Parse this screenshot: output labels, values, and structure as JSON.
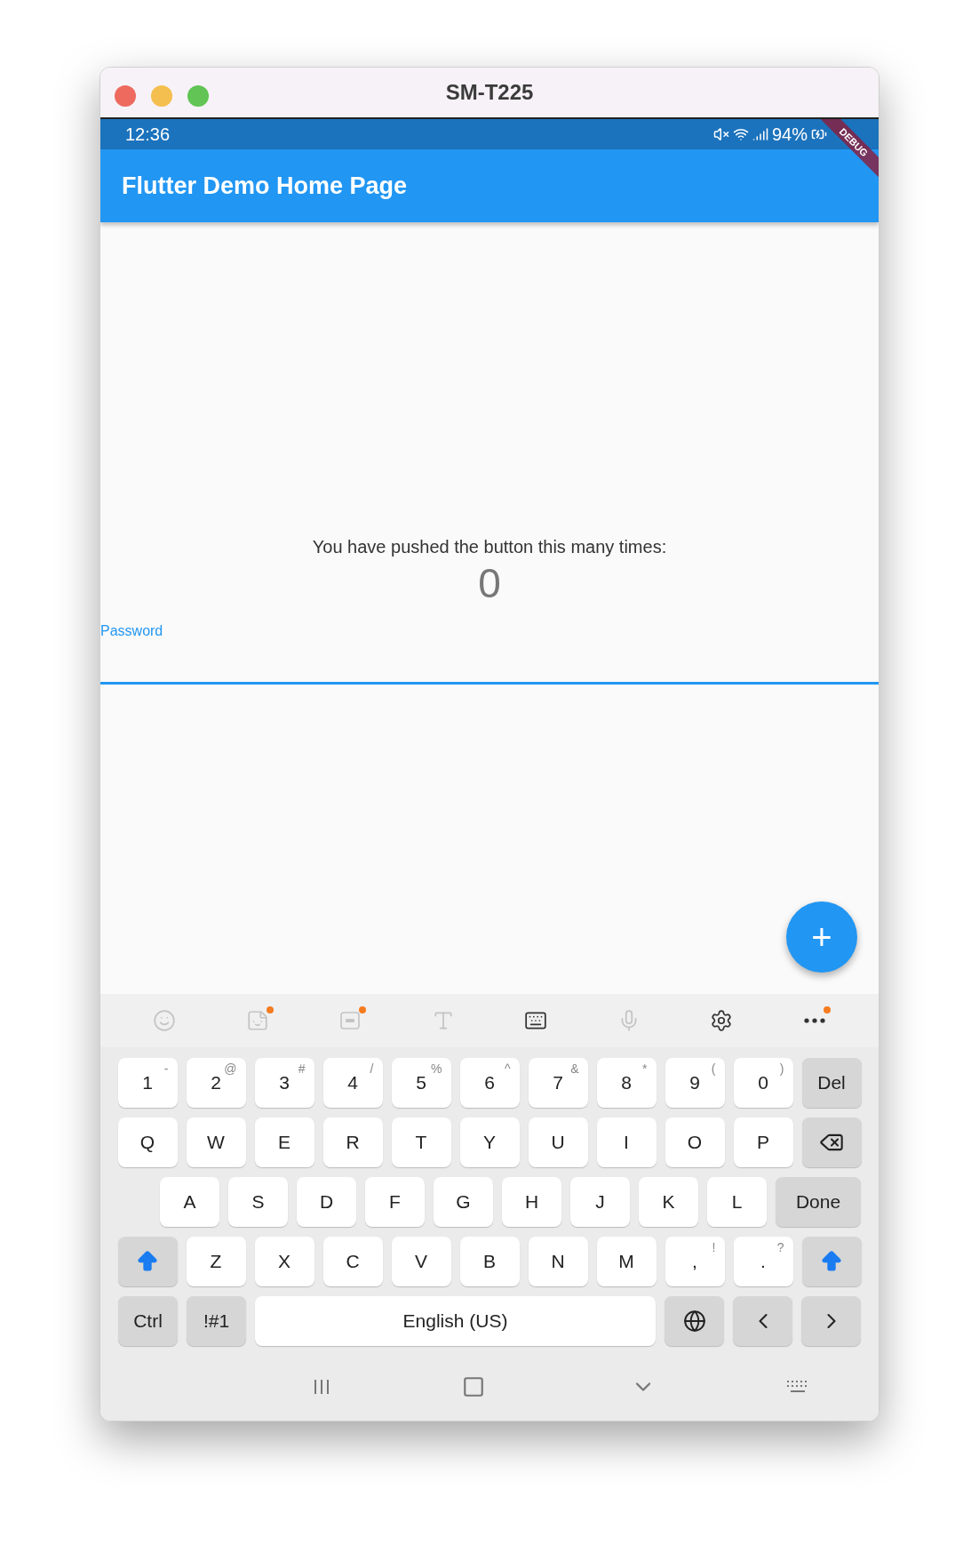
{
  "window": {
    "title": "SM-T225"
  },
  "status_bar": {
    "time": "12:36",
    "battery": "94%"
  },
  "debug_banner": "DEBUG",
  "app_bar": {
    "title": "Flutter Demo Home Page"
  },
  "body": {
    "message": "You have pushed the button this many times:",
    "counter": "0"
  },
  "password_field": {
    "label": "Password",
    "focused": true
  },
  "fab": {
    "label": "+"
  },
  "keyboard_toolbar": [
    {
      "kind": "emoji",
      "disabled": true,
      "dot": false
    },
    {
      "kind": "sticker",
      "disabled": true,
      "dot": true
    },
    {
      "kind": "gif",
      "disabled": true,
      "dot": true
    },
    {
      "kind": "handwriting",
      "disabled": true,
      "dot": false
    },
    {
      "kind": "keyboard",
      "disabled": false,
      "dot": false
    },
    {
      "kind": "mic",
      "disabled": true,
      "dot": false
    },
    {
      "kind": "settings",
      "disabled": false,
      "dot": false
    },
    {
      "kind": "more",
      "disabled": false,
      "dot": true
    }
  ],
  "keyboard_rows": [
    [
      {
        "kind": "char",
        "label": "1",
        "sub": "-"
      },
      {
        "kind": "char",
        "label": "2",
        "sub": "@"
      },
      {
        "kind": "char",
        "label": "3",
        "sub": "#"
      },
      {
        "kind": "char",
        "label": "4",
        "sub": "/"
      },
      {
        "kind": "char",
        "label": "5",
        "sub": "%"
      },
      {
        "kind": "char",
        "label": "6",
        "sub": "^"
      },
      {
        "kind": "char",
        "label": "7",
        "sub": "&"
      },
      {
        "kind": "char",
        "label": "8",
        "sub": "*"
      },
      {
        "kind": "char",
        "label": "9",
        "sub": "("
      },
      {
        "kind": "char",
        "label": "0",
        "sub": ")"
      },
      {
        "kind": "function",
        "label": "Del"
      }
    ],
    [
      {
        "kind": "char",
        "label": "Q"
      },
      {
        "kind": "char",
        "label": "W"
      },
      {
        "kind": "char",
        "label": "E"
      },
      {
        "kind": "char",
        "label": "R"
      },
      {
        "kind": "char",
        "label": "T"
      },
      {
        "kind": "char",
        "label": "Y"
      },
      {
        "kind": "char",
        "label": "U"
      },
      {
        "kind": "char",
        "label": "I"
      },
      {
        "kind": "char",
        "label": "O"
      },
      {
        "kind": "char",
        "label": "P"
      },
      {
        "kind": "backspace"
      }
    ],
    [
      {
        "kind": "char",
        "label": "A"
      },
      {
        "kind": "char",
        "label": "S"
      },
      {
        "kind": "char",
        "label": "D"
      },
      {
        "kind": "char",
        "label": "F"
      },
      {
        "kind": "char",
        "label": "G"
      },
      {
        "kind": "char",
        "label": "H"
      },
      {
        "kind": "char",
        "label": "J"
      },
      {
        "kind": "char",
        "label": "K"
      },
      {
        "kind": "char",
        "label": "L"
      },
      {
        "kind": "action",
        "label": "Done"
      }
    ],
    [
      {
        "kind": "shift"
      },
      {
        "kind": "char",
        "label": "Z"
      },
      {
        "kind": "char",
        "label": "X"
      },
      {
        "kind": "char",
        "label": "C"
      },
      {
        "kind": "char",
        "label": "V"
      },
      {
        "kind": "char",
        "label": "B"
      },
      {
        "kind": "char",
        "label": "N"
      },
      {
        "kind": "char",
        "label": "M"
      },
      {
        "kind": "char",
        "label": ",",
        "sub": "!"
      },
      {
        "kind": "char",
        "label": ".",
        "sub": "?"
      },
      {
        "kind": "shift"
      }
    ],
    [
      {
        "kind": "function",
        "label": "Ctrl"
      },
      {
        "kind": "function",
        "label": "!#1"
      },
      {
        "kind": "space",
        "label": "English (US)"
      },
      {
        "kind": "globe"
      },
      {
        "kind": "left"
      },
      {
        "kind": "right"
      }
    ]
  ]
}
